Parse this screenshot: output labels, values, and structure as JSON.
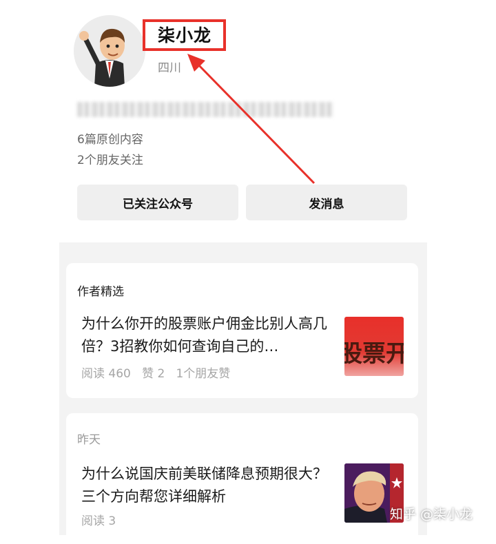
{
  "profile": {
    "name": "柒小龙",
    "region": "四川",
    "stats": {
      "original_posts": "6篇原创内容",
      "friends_following": "2个朋友关注"
    },
    "actions": {
      "follow_label": "已关注公众号",
      "message_label": "发消息"
    }
  },
  "feed": {
    "featured": {
      "heading": "作者精选",
      "article": {
        "title": "为什么你开的股票账户佣金比别人高几倍？3招教你如何查询自己的…",
        "meta": "阅读 460   赞 2   1个朋友赞",
        "thumb_text": "股票开户"
      }
    },
    "yesterday": {
      "heading": "昨天",
      "article": {
        "title": "为什么说国庆前美联储降息预期很大？三个方向帮您详细解析",
        "meta": "阅读 3"
      }
    }
  },
  "watermark": "知乎 @柒小龙",
  "colors": {
    "highlight": "#e8312a",
    "button_bg": "#efefef",
    "feed_bg": "#f3f3f3"
  }
}
